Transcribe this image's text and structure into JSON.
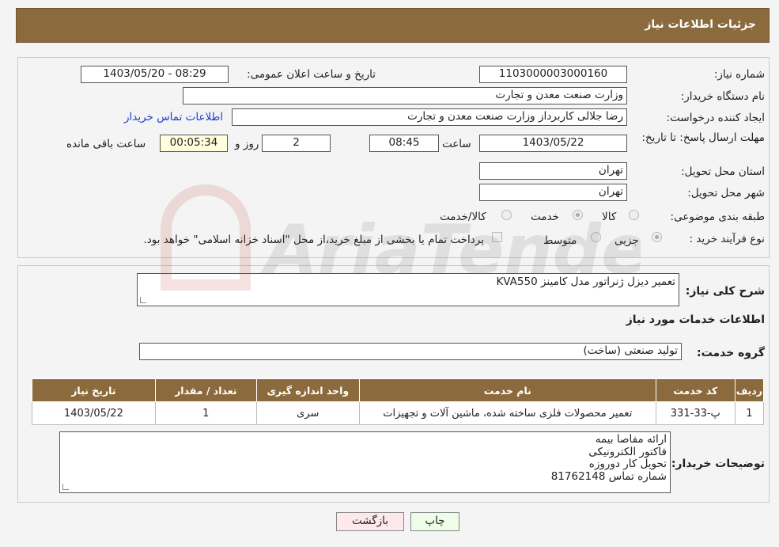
{
  "header": {
    "title": "جزئیات اطلاعات نیاز"
  },
  "need": {
    "number_label": "شماره نیاز:",
    "number_value": "1103000003000160",
    "announce_label": "تاریخ و ساعت اعلان عمومی:",
    "announce_value": "1403/05/20 - 08:29",
    "buyer_label": "نام دستگاه خریدار:",
    "buyer_value": "وزارت صنعت معدن و تجارت",
    "creator_label": "ایجاد کننده درخواست:",
    "creator_value": "رضا جلالی کاربرداز وزارت صنعت معدن و تجارت",
    "contact_link": "اطلاعات تماس خریدار",
    "deadline_label": "مهلت ارسال پاسخ: تا تاریخ:",
    "deadline_date": "1403/05/22",
    "time_label": "ساعت",
    "deadline_time": "08:45",
    "days_value": "2",
    "days_label": "روز و",
    "remaining_value": "00:05:34",
    "remaining_label": "ساعت باقی مانده",
    "province_label": "استان محل تحویل:",
    "province_value": "تهران",
    "city_label": "شهر محل تحویل:",
    "city_value": "تهران",
    "category_label": "طبقه بندی موضوعی:",
    "category_options": [
      "کالا",
      "خدمت",
      "کالا/خدمت"
    ],
    "process_label": "نوع فرآیند خرید :",
    "process_options": [
      "جزیی",
      "متوسط"
    ],
    "payment_note": "پرداخت تمام یا بخشی از مبلغ خرید،از محل \"اسناد خزانه اسلامی\" خواهد بود."
  },
  "details": {
    "summary_label": "شرح کلی نیاز:",
    "summary_value": "تعمیر دیزل ژنراتور مدل کامینز KVA550",
    "services_title": "اطلاعات خدمات مورد نیاز",
    "group_label": "گروه خدمت:",
    "group_value": "تولید صنعتی (ساخت)",
    "table_headers": [
      "ردیف",
      "کد خدمت",
      "نام خدمت",
      "واحد اندازه گیری",
      "تعداد / مقدار",
      "تاریخ نیاز"
    ],
    "rows": [
      {
        "index": "1",
        "code": "پ-33-331",
        "name": "تعمیر محصولات فلزی ساخته شده، ماشین آلات و تجهیزات",
        "unit": "سری",
        "qty": "1",
        "date": "1403/05/22"
      }
    ],
    "buyer_notes_label": "توضیحات خریدار:",
    "buyer_notes": [
      "ارائه مفاصا بیمه",
      "فاکتور الکترونیکی",
      "تحویل کار دوروزه",
      "شماره تماس 81762148"
    ]
  },
  "buttons": {
    "print": "چاپ",
    "back": "بازگشت"
  },
  "watermark": {
    "text": "AriaTender.neT"
  },
  "colors": {
    "header_brown": "#8b6b3d",
    "link_blue": "#1f3fd6"
  }
}
